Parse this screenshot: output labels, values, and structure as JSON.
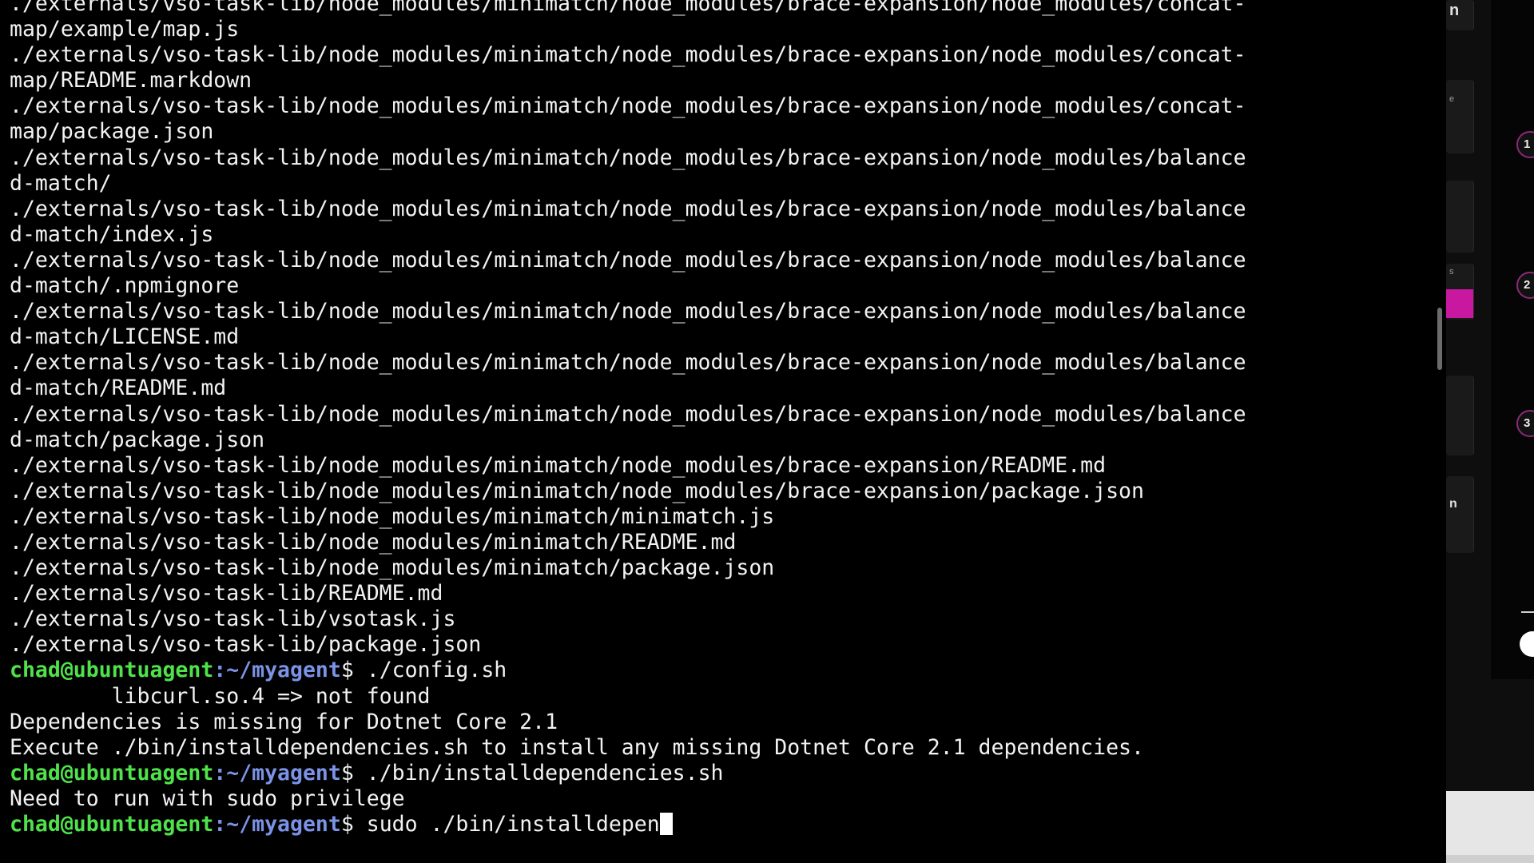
{
  "terminal": {
    "prompt": {
      "user_host": "chad@ubuntuagent",
      "path": ":~/myagent",
      "symbol": "$ "
    },
    "lines": [
      {
        "type": "out",
        "text": "./externals/vso-task-lib/node_modules/minimatch/node_modules/brace-expansion/node_modules/concat-"
      },
      {
        "type": "out",
        "text": "map/example/map.js"
      },
      {
        "type": "out",
        "text": "./externals/vso-task-lib/node_modules/minimatch/node_modules/brace-expansion/node_modules/concat-"
      },
      {
        "type": "out",
        "text": "map/README.markdown"
      },
      {
        "type": "out",
        "text": "./externals/vso-task-lib/node_modules/minimatch/node_modules/brace-expansion/node_modules/concat-"
      },
      {
        "type": "out",
        "text": "map/package.json"
      },
      {
        "type": "out",
        "text": "./externals/vso-task-lib/node_modules/minimatch/node_modules/brace-expansion/node_modules/balance"
      },
      {
        "type": "out",
        "text": "d-match/"
      },
      {
        "type": "out",
        "text": "./externals/vso-task-lib/node_modules/minimatch/node_modules/brace-expansion/node_modules/balance"
      },
      {
        "type": "out",
        "text": "d-match/index.js"
      },
      {
        "type": "out",
        "text": "./externals/vso-task-lib/node_modules/minimatch/node_modules/brace-expansion/node_modules/balance"
      },
      {
        "type": "out",
        "text": "d-match/.npmignore"
      },
      {
        "type": "out",
        "text": "./externals/vso-task-lib/node_modules/minimatch/node_modules/brace-expansion/node_modules/balance"
      },
      {
        "type": "out",
        "text": "d-match/LICENSE.md"
      },
      {
        "type": "out",
        "text": "./externals/vso-task-lib/node_modules/minimatch/node_modules/brace-expansion/node_modules/balance"
      },
      {
        "type": "out",
        "text": "d-match/README.md"
      },
      {
        "type": "out",
        "text": "./externals/vso-task-lib/node_modules/minimatch/node_modules/brace-expansion/node_modules/balance"
      },
      {
        "type": "out",
        "text": "d-match/package.json"
      },
      {
        "type": "out",
        "text": "./externals/vso-task-lib/node_modules/minimatch/node_modules/brace-expansion/README.md"
      },
      {
        "type": "out",
        "text": "./externals/vso-task-lib/node_modules/minimatch/node_modules/brace-expansion/package.json"
      },
      {
        "type": "out",
        "text": "./externals/vso-task-lib/node_modules/minimatch/minimatch.js"
      },
      {
        "type": "out",
        "text": "./externals/vso-task-lib/node_modules/minimatch/README.md"
      },
      {
        "type": "out",
        "text": "./externals/vso-task-lib/node_modules/minimatch/package.json"
      },
      {
        "type": "out",
        "text": "./externals/vso-task-lib/README.md"
      },
      {
        "type": "out",
        "text": "./externals/vso-task-lib/vsotask.js"
      },
      {
        "type": "out",
        "text": "./externals/vso-task-lib/package.json"
      },
      {
        "type": "cmd",
        "text": "./config.sh"
      },
      {
        "type": "out",
        "text": "        libcurl.so.4 => not found"
      },
      {
        "type": "out",
        "text": "Dependencies is missing for Dotnet Core 2.1"
      },
      {
        "type": "out",
        "text": "Execute ./bin/installdependencies.sh to install any missing Dotnet Core 2.1 dependencies."
      },
      {
        "type": "cmd",
        "text": "./bin/installdependencies.sh"
      },
      {
        "type": "out",
        "text": "Need to run with sudo privilege"
      },
      {
        "type": "input",
        "text": "sudo ./bin/installdepen"
      }
    ]
  },
  "side_panel": {
    "cards": [
      {
        "char": "n"
      },
      {
        "char": "e"
      },
      {
        "char": "s"
      },
      {
        "char": "n"
      }
    ],
    "steps": [
      "1",
      "2",
      "3"
    ],
    "accent_color": "#c8189f"
  }
}
